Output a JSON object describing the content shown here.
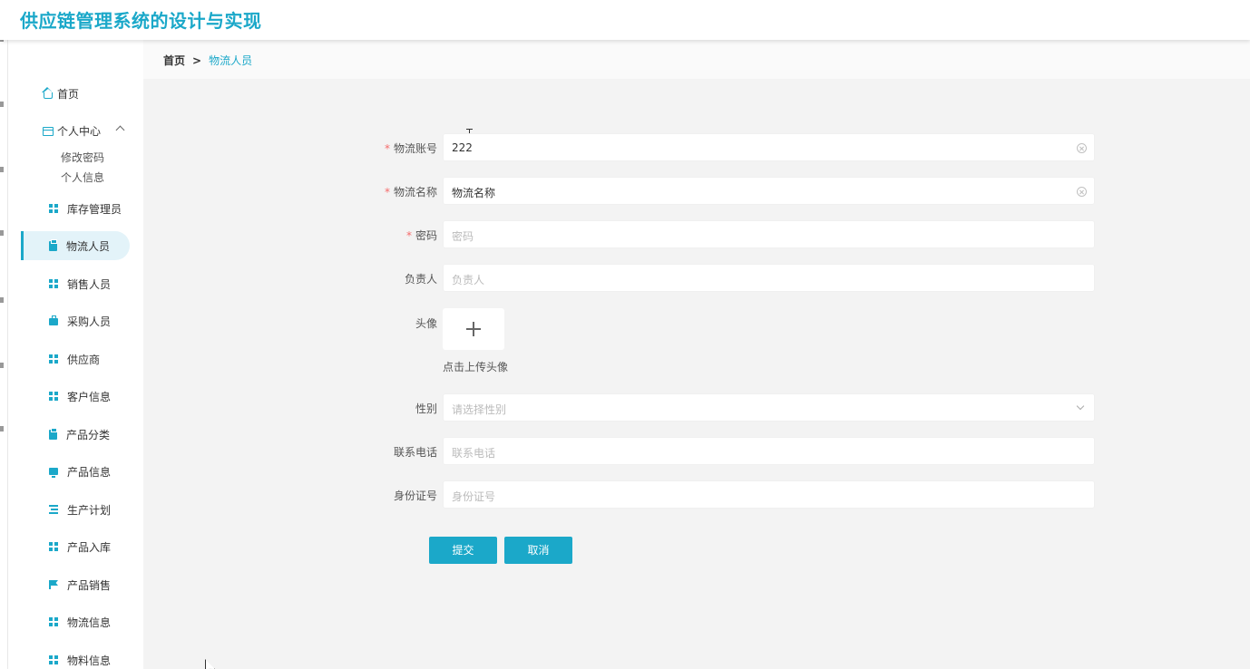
{
  "app": {
    "title": "供应链管理系统的设计与实现"
  },
  "breadcrumb": {
    "home": "首页",
    "separator": ">",
    "current": "物流人员"
  },
  "sidebar": {
    "home": {
      "label": "首页",
      "icon": "home-icon"
    },
    "personal": {
      "label": "个人中心",
      "icon": "card-icon",
      "expanded": true,
      "children": [
        "修改密码",
        "个人信息"
      ]
    },
    "items": [
      {
        "label": "库存管理员",
        "icon": "grid-icon",
        "active": false
      },
      {
        "label": "物流人员",
        "icon": "clipboard-icon",
        "active": true
      },
      {
        "label": "销售人员",
        "icon": "grid-icon",
        "active": false
      },
      {
        "label": "采购人员",
        "icon": "briefcase-icon",
        "active": false
      },
      {
        "label": "供应商",
        "icon": "grid-icon",
        "active": false
      },
      {
        "label": "客户信息",
        "icon": "grid-icon",
        "active": false
      },
      {
        "label": "产品分类",
        "icon": "clipboard-icon",
        "active": false
      },
      {
        "label": "产品信息",
        "icon": "monitor-icon",
        "active": false
      },
      {
        "label": "生产计划",
        "icon": "list-icon",
        "active": false
      },
      {
        "label": "产品入库",
        "icon": "grid-icon",
        "active": false
      },
      {
        "label": "产品销售",
        "icon": "flag-icon",
        "active": false
      },
      {
        "label": "物流信息",
        "icon": "grid-icon",
        "active": false
      },
      {
        "label": "物料信息",
        "icon": "grid-icon",
        "active": false
      }
    ]
  },
  "form": {
    "account": {
      "label": "物流账号",
      "required": true,
      "value": "222",
      "placeholder": ""
    },
    "name": {
      "label": "物流名称",
      "required": true,
      "value": "物流名称",
      "placeholder": ""
    },
    "password": {
      "label": "密码",
      "required": true,
      "value": "",
      "placeholder": "密码"
    },
    "manager": {
      "label": "负责人",
      "required": false,
      "value": "",
      "placeholder": "负责人"
    },
    "avatar": {
      "label": "头像",
      "tip": "点击上传头像"
    },
    "gender": {
      "label": "性别",
      "placeholder": "请选择性别"
    },
    "phone": {
      "label": "联系电话",
      "value": "",
      "placeholder": "联系电话"
    },
    "idcard": {
      "label": "身份证号",
      "value": "",
      "placeholder": "身份证号"
    },
    "required_mark": "*"
  },
  "buttons": {
    "submit": "提交",
    "cancel": "取消"
  },
  "colors": {
    "accent": "#1ba8c9",
    "required": "#f56c6c",
    "background": "#f3f3f3"
  }
}
